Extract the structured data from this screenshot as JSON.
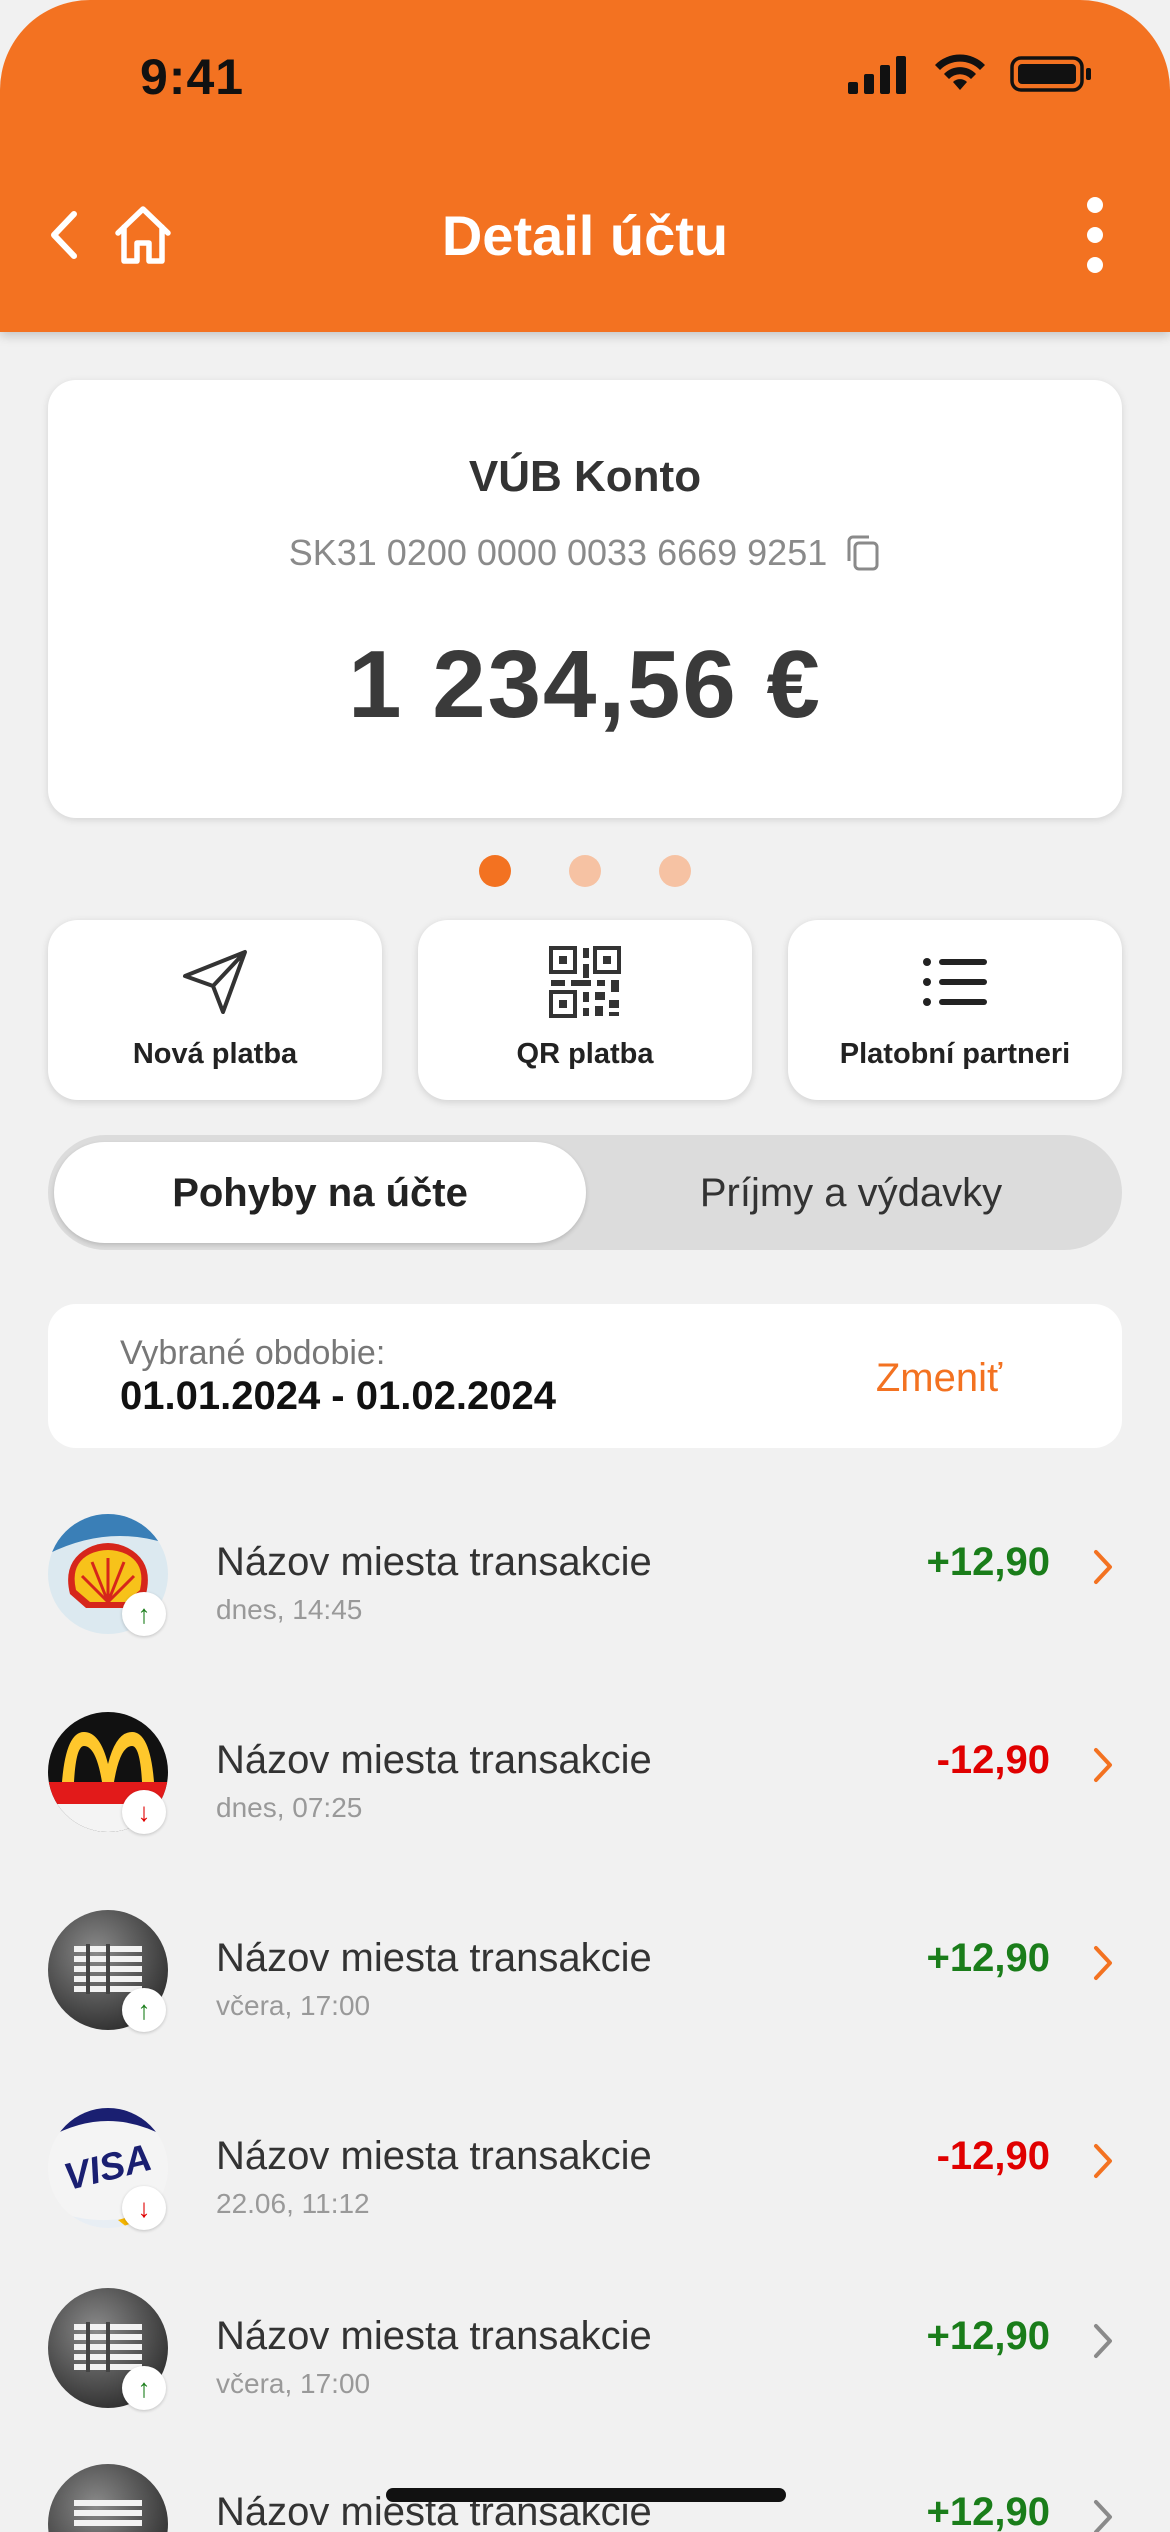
{
  "status_bar": {
    "time": "9:41"
  },
  "header": {
    "title": "Detail účtu"
  },
  "account": {
    "name": "VÚB Konto",
    "iban": "SK31 0200 0000 0033 6669 9251",
    "balance": "1 234,56 €"
  },
  "carousel": {
    "page_count": 3,
    "active_page": 1
  },
  "actions": [
    {
      "label": "Nová platba",
      "icon": "send-icon"
    },
    {
      "label": "QR platba",
      "icon": "qr-code-icon"
    },
    {
      "label": "Platobní partneri",
      "icon": "list-icon"
    }
  ],
  "tabs": {
    "active": "Pohyby na účte",
    "inactive": "Príjmy a výdavky"
  },
  "period": {
    "label": "Vybrané obdobie:",
    "value": "01.01.2024 - 01.02.2024",
    "change_label": "Zmeniť"
  },
  "transactions": [
    {
      "name": "Názov miesta transakcie",
      "date": "dnes, 14:45",
      "amount": "+12,90",
      "direction": "in",
      "logo": "shell-logo"
    },
    {
      "name": "Názov miesta transakcie",
      "date": "dnes, 07:25",
      "amount": "-12,90",
      "direction": "out",
      "logo": "mcdonalds-logo"
    },
    {
      "name": "Názov miesta transakcie",
      "date": "včera, 17:00",
      "amount": "+12,90",
      "direction": "in",
      "logo": "ibm-logo"
    },
    {
      "name": "Názov miesta transakcie",
      "date": "22.06, 11:12",
      "amount": "-12,90",
      "direction": "out",
      "logo": "visa-logo"
    },
    {
      "name": "Názov miesta transakcie",
      "date": "včera, 17:00",
      "amount": "+12,90",
      "direction": "in",
      "logo": "ibm-logo"
    },
    {
      "name": "Názov miesta transakcie",
      "date": "",
      "amount": "+12,90",
      "direction": "in",
      "logo": "ibm-logo"
    }
  ],
  "colors": {
    "brand": "#f37221",
    "positive": "#1a7d1a",
    "negative": "#e00000"
  }
}
